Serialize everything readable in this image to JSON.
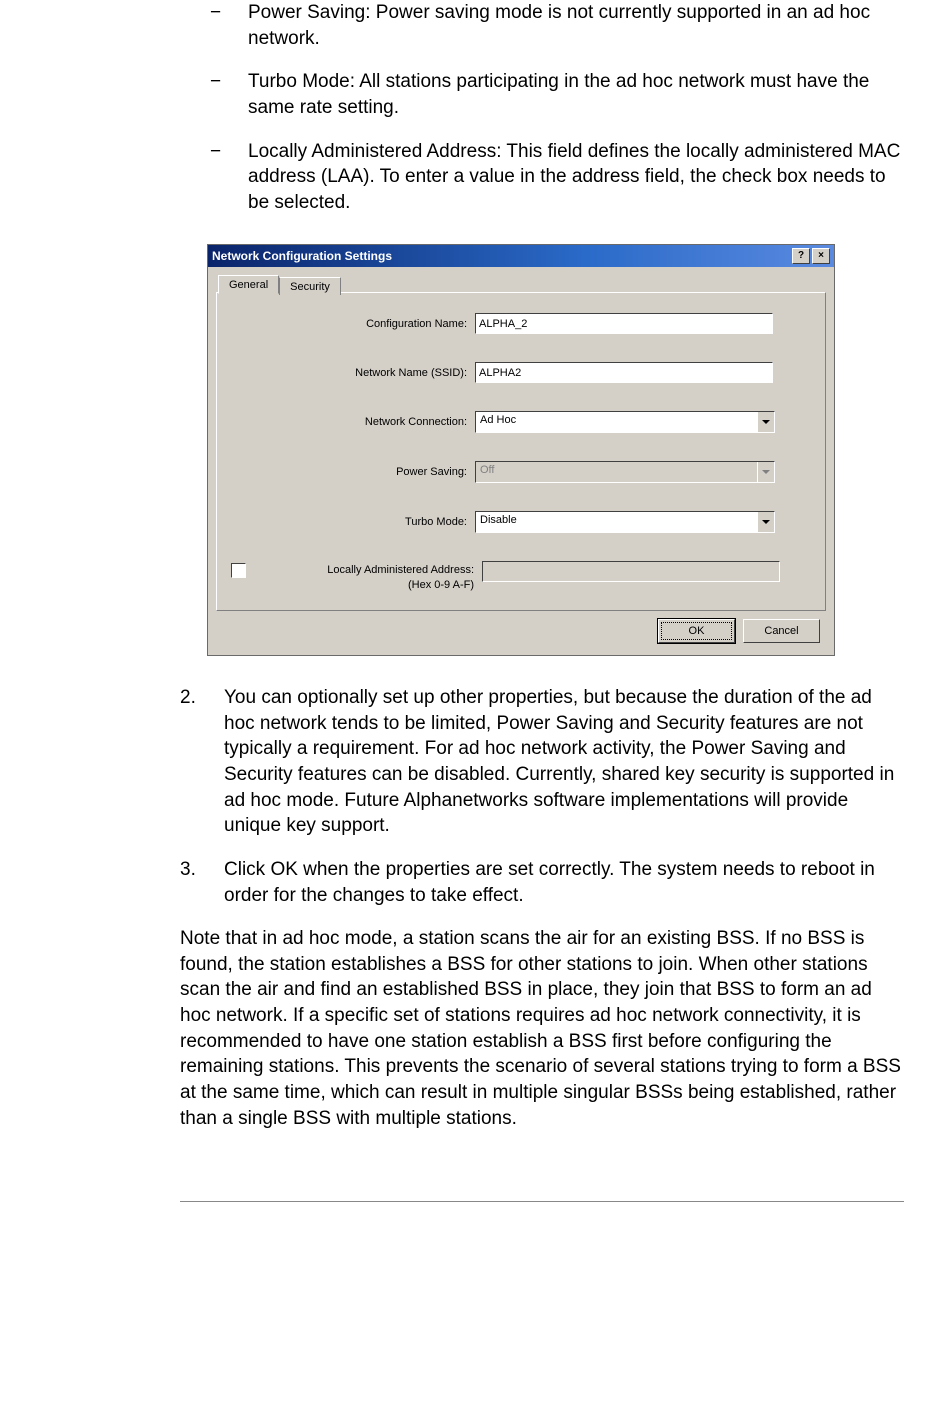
{
  "bullets": [
    "Power Saving: Power saving mode is not currently supported in an ad hoc network.",
    "Turbo Mode: All stations participating in the ad hoc network must have the same rate setting.",
    "Locally Administered Address: This field defines the locally administered MAC address (LAA). To enter a value in the address field, the check box needs to be selected."
  ],
  "dialog": {
    "title": "Network Configuration Settings",
    "help_glyph": "?",
    "close_glyph": "×",
    "tabs": {
      "general": "General",
      "security": "Security"
    },
    "fields": {
      "configuration_name": {
        "label": "Configuration Name:",
        "value": "ALPHA_2"
      },
      "network_name_ssid": {
        "label": "Network Name (SSID):",
        "value": "ALPHA2"
      },
      "network_connection": {
        "label": "Network Connection:",
        "value": "Ad Hoc"
      },
      "power_saving": {
        "label": "Power Saving:",
        "value": "Off"
      },
      "turbo_mode": {
        "label": "Turbo Mode:",
        "value": "Disable"
      },
      "laa": {
        "label_line1": "Locally Administered Address:",
        "label_line2": "(Hex 0-9 A-F)",
        "value": ""
      }
    },
    "buttons": {
      "ok": "OK",
      "cancel": "Cancel"
    }
  },
  "numbered": [
    {
      "num": "2.",
      "text": "You can optionally set up other properties, but because the duration of the ad hoc network tends to be limited, Power Saving and Security features are not typically a requirement. For ad hoc network activity, the Power Saving and Security features can be disabled. Currently, shared key security is supported in ad hoc mode. Future Alphanetworks software implementations will provide unique key support."
    },
    {
      "num": "3.",
      "text": "Click OK when the properties are set correctly. The system needs to reboot in order for the changes to take effect."
    }
  ],
  "note": "Note that in ad hoc mode, a station scans the air for an existing BSS. If no BSS is found, the station establishes a BSS for other stations to join. When other stations scan the air and find an established BSS in place, they join that BSS to form an ad hoc network. If a specific set of stations requires ad hoc network connectivity, it is recommended to have one station establish a BSS first before configuring the remaining stations. This prevents the scenario of several stations trying to form a BSS at the same time, which can result in multiple singular BSSs being established, rather than a single BSS with multiple stations."
}
